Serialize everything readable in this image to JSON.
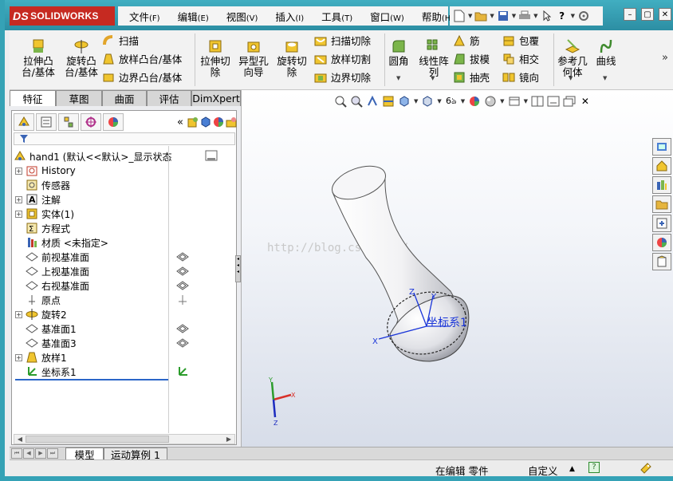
{
  "app": {
    "brand": "SOLIDWORKS",
    "brand_prefix": "DS"
  },
  "menu": [
    {
      "label": "文件",
      "key": "(F)"
    },
    {
      "label": "编辑",
      "key": "(E)"
    },
    {
      "label": "视图",
      "key": "(V)"
    },
    {
      "label": "插入",
      "key": "(I)"
    },
    {
      "label": "工具",
      "key": "(T)"
    },
    {
      "label": "窗口",
      "key": "(W)"
    },
    {
      "label": "帮助",
      "key": "(H)"
    }
  ],
  "ribbon": {
    "extrude_boss": "拉伸凸\n台/基体",
    "revolve_boss": "旋转凸\n台/基体",
    "sweep": "扫描",
    "loft": "放样凸台/基体",
    "boundary_boss": "边界凸台/基体",
    "extrude_cut": "拉伸切\n除",
    "hole_wizard": "异型孔\n向导",
    "revolve_cut": "旋转切\n除",
    "swept_cut": "扫描切除",
    "lofted_cut": "放样切割",
    "boundary_cut": "边界切除",
    "fillet": "圆角",
    "linear_pattern": "线性阵\n列",
    "rib": "筋",
    "draft": "拔模",
    "shell": "抽壳",
    "wrap": "包覆",
    "intersect": "相交",
    "mirror": "镜向",
    "ref_geometry": "参考几\n何体",
    "curves": "曲线"
  },
  "tabs": [
    "特征",
    "草图",
    "曲面",
    "评估",
    "DimXpert"
  ],
  "tree": {
    "root": "hand1  (默认<<默认>_显示状态",
    "items": [
      {
        "label": "History",
        "expand": true,
        "icon": "history-icon"
      },
      {
        "label": "传感器",
        "expand": false,
        "icon": "sensor-icon"
      },
      {
        "label": "注解",
        "expand": true,
        "icon": "annotation-icon"
      },
      {
        "label": "实体(1)",
        "expand": true,
        "icon": "solid-bodies-icon"
      },
      {
        "label": "方程式",
        "expand": false,
        "icon": "equations-icon"
      },
      {
        "label": "材质 <未指定>",
        "expand": false,
        "icon": "material-icon"
      },
      {
        "label": "前视基准面",
        "expand": false,
        "icon": "plane-icon"
      },
      {
        "label": "上视基准面",
        "expand": false,
        "icon": "plane-icon"
      },
      {
        "label": "右视基准面",
        "expand": false,
        "icon": "plane-icon"
      },
      {
        "label": "原点",
        "expand": false,
        "icon": "origin-icon"
      },
      {
        "label": "旋转2",
        "expand": true,
        "icon": "revolve-icon"
      },
      {
        "label": "基准面1",
        "expand": false,
        "icon": "plane-icon"
      },
      {
        "label": "基准面3",
        "expand": false,
        "icon": "plane-icon"
      },
      {
        "label": "放样1",
        "expand": true,
        "icon": "loft-icon"
      },
      {
        "label": "坐标系1",
        "expand": false,
        "icon": "coordinate-system-icon"
      }
    ]
  },
  "viewport": {
    "watermark": "http://blog.csdn.net/",
    "coord_label": "坐标系1",
    "axis_x": "X",
    "axis_y": "Y",
    "axis_z": "Z"
  },
  "bottom_tabs": [
    "模型",
    "运动算例 1"
  ],
  "status": {
    "editing": "在编辑 零件",
    "units": "自定义",
    "help": "?"
  },
  "colors": {
    "title_bar": "#35a2b6",
    "logo_red": "#c62a21",
    "model_gray": "#e8e8ec"
  }
}
